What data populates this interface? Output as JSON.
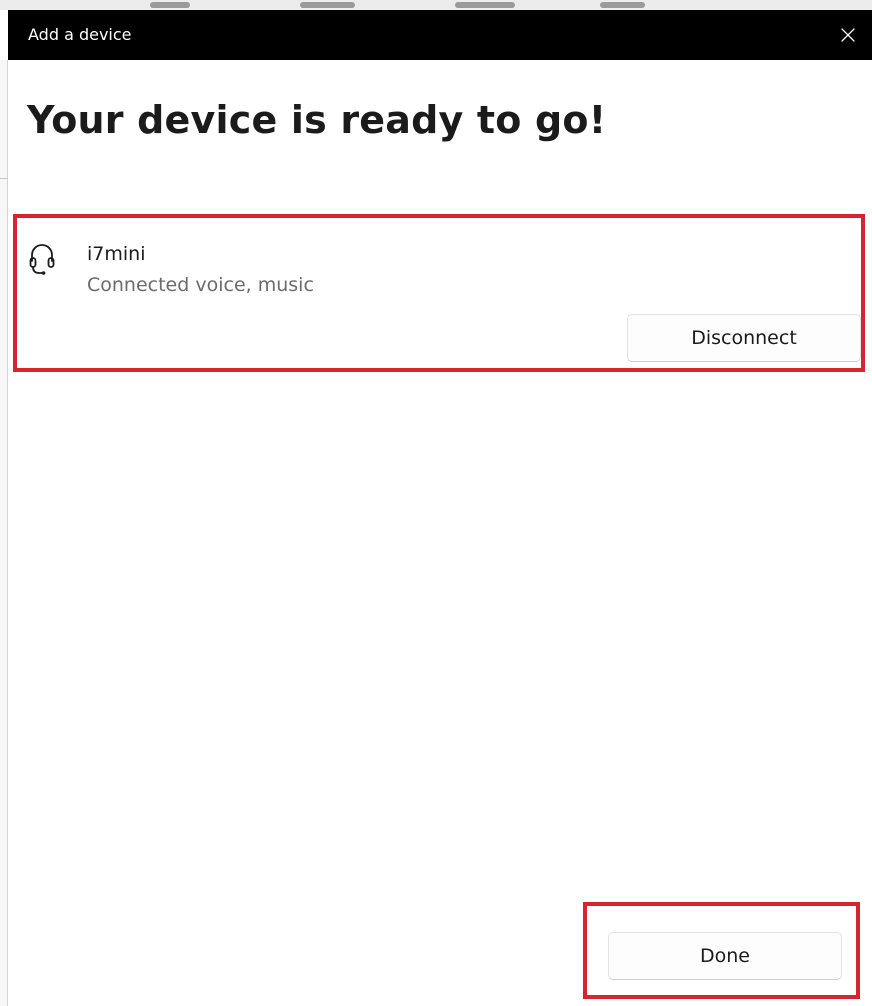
{
  "window": {
    "title": "Add a device",
    "close_icon": "close-icon"
  },
  "main": {
    "heading": "Your device is ready to go!"
  },
  "device": {
    "icon": "headset-icon",
    "name": "i7mini",
    "status": "Connected voice, music",
    "disconnect_label": "Disconnect"
  },
  "footer": {
    "done_label": "Done"
  },
  "colors": {
    "titlebar_background": "#000000",
    "highlight_border": "#d9232e",
    "primary_text": "#1b1b1b",
    "secondary_text": "#6b6b6b"
  }
}
